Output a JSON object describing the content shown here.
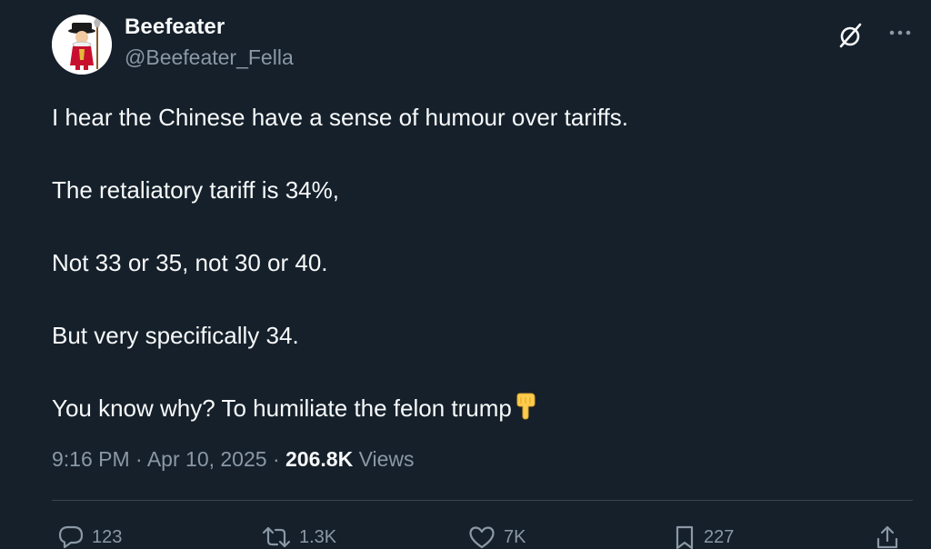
{
  "author": {
    "display_name": "Beefeater",
    "handle": "@Beefeater_Fella",
    "avatar_icon": "beefeater-guard-avatar"
  },
  "header_actions": {
    "grok_icon": "grok-slash-circle-icon",
    "more_icon": "more-dots-icon"
  },
  "tweet": {
    "lines": [
      "I hear the Chinese have a sense of humour over tariffs.",
      "The retaliatory tariff is 34%,",
      "Not 33 or 35, not 30 or 40.",
      "But very specifically 34.",
      "You know why?  To humiliate the felon trump"
    ],
    "trailing_emoji": "backhand-index-pointing-down"
  },
  "meta": {
    "time": "9:16 PM",
    "separator": "·",
    "date": "Apr 10, 2025",
    "views_count": "206.8K",
    "views_label": "Views"
  },
  "actions": {
    "replies": "123",
    "reposts": "1.3K",
    "likes": "7K",
    "bookmarks": "227"
  },
  "colors": {
    "background": "#15202b",
    "text_primary": "#f7f9f9",
    "text_secondary": "#8b98a5",
    "divider": "#38444d"
  }
}
